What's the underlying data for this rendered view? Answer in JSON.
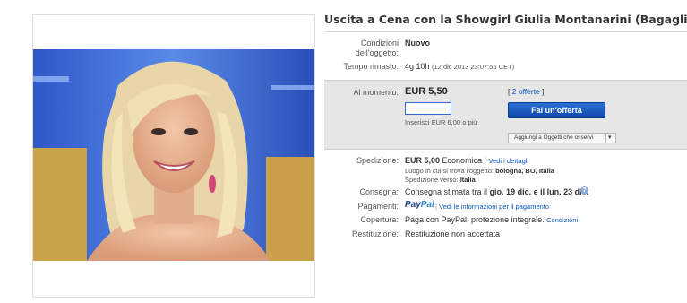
{
  "listing": {
    "title": "Uscita a Cena con la Showgirl Giulia Montanarini (Bagaglino,Uomini e Donne,",
    "condition_label_1": "Condizioni",
    "condition_label_2": "dell'oggetto:",
    "condition_value": "Nuovo",
    "time_label": "Tempo rimasto:",
    "time_value": "4g 10h",
    "time_detail": "(12 dic 2013  23:07:56 CET)"
  },
  "bid": {
    "current_label": "Al momento:",
    "price": "EUR 5,50",
    "offers_open": "[",
    "offers_link": "2 offerte",
    "offers_close": "]",
    "input_value": "",
    "hint": "Inserisci EUR 6,00 o più",
    "button_label": "Fai un'offerta",
    "watch_label": "Aggiungi a Oggetti che osservi",
    "watch_arrow": "▾"
  },
  "shipping": {
    "label": "Spedizione:",
    "cost": "EUR 5,00",
    "method": "Economica",
    "sep": "|",
    "details_link": "Vedi i dettagli",
    "location_label": "Luogo in cui si trova l'oggetto:",
    "location_value": "bologna, BO, Italia",
    "ships_to_label": "Spedizione verso:",
    "ships_to_value": "Italia"
  },
  "delivery": {
    "label": "Consegna:",
    "prefix": "Consegna stimata tra il",
    "range": "gio. 19 dic. e il lun. 23 dic."
  },
  "payment": {
    "label": "Pagamenti:",
    "paypal_a": "Pay",
    "paypal_b": "Pal",
    "sep": "|",
    "info_link": "Vedi le informazioni per il pagamento"
  },
  "coverage": {
    "label": "Copertura:",
    "text": "Paga con PayPal: protezione integrale.",
    "link": "Condizioni"
  },
  "returns": {
    "label": "Restituzione:",
    "value": "Restituzione non accettata"
  },
  "icons": {
    "help": "?"
  },
  "colors": {
    "link": "#0654ba",
    "button": "#1d5bc4",
    "bid_panel": "#e6e6e6"
  }
}
